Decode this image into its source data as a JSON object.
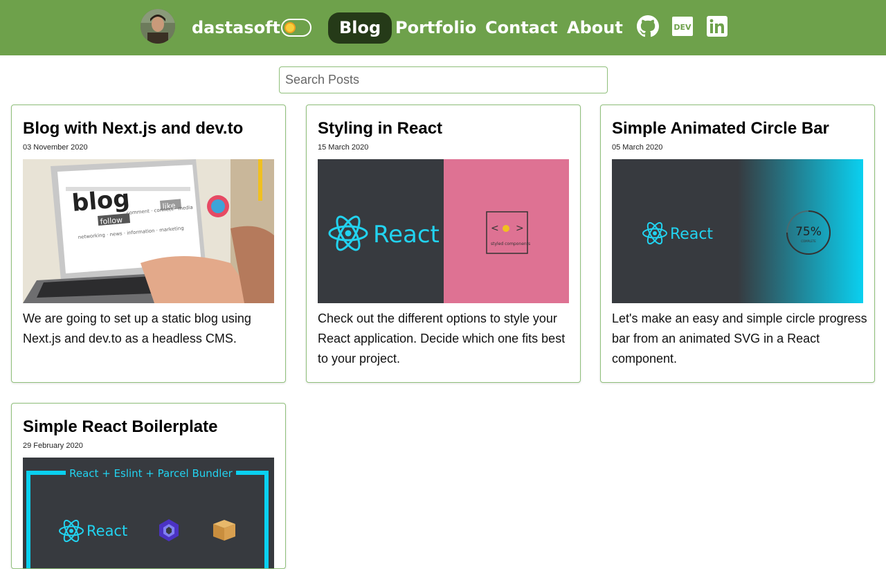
{
  "header": {
    "brand": "dastasoft",
    "nav": [
      "Blog",
      "Portfolio",
      "Contact",
      "About"
    ],
    "active_nav": "Blog",
    "social_icons": [
      "github-icon",
      "dev-icon",
      "linkedin-icon"
    ],
    "bar_color": "#6ea14b",
    "active_color": "#253a18"
  },
  "search": {
    "placeholder": "Search Posts"
  },
  "posts": [
    {
      "title": "Blog with Next.js and dev.to",
      "date": "03 November 2020",
      "description": "We are going to set up a static blog using Next.js and dev.to as a headless CMS.",
      "image_text": {
        "word1": "blog",
        "word2": "follow",
        "word3": "like",
        "word4": "comment · connect · media",
        "word5": "networking · news · information · marketing"
      }
    },
    {
      "title": "Styling in React",
      "date": "15 March 2020",
      "description": "Check out the different options to style your React application. Decide which one fits best to your project.",
      "image_text": {
        "react": "React",
        "styled": "styled components"
      }
    },
    {
      "title": "Simple Animated Circle Bar",
      "date": "05 March 2020",
      "description": "Let's make an easy and simple circle progress bar from an animated SVG in a React component.",
      "image_text": {
        "react": "React",
        "progress": "75%",
        "progress_sub": "COMPLETE"
      }
    },
    {
      "title": "Simple React Boilerplate",
      "date": "29 February 2020",
      "description": "",
      "image_text": {
        "banner": "React + Eslint + Parcel Bundler",
        "react": "React"
      }
    }
  ]
}
